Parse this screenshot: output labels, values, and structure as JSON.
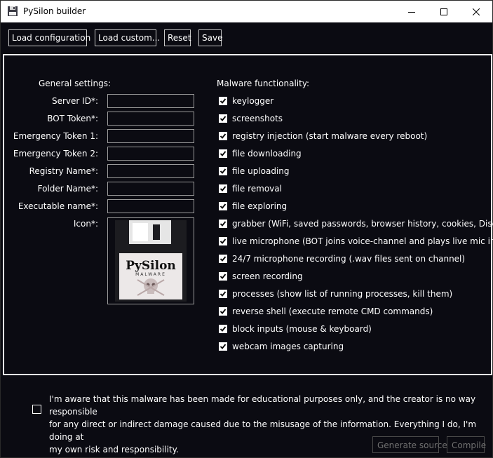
{
  "window": {
    "title": "PySilon builder",
    "app_icon": "floppy-disk-icon",
    "controls": [
      "minimize-icon",
      "maximize-icon",
      "close-icon"
    ]
  },
  "toolbar": {
    "load_configuration": "Load configuration",
    "load_custom": "Load custom...",
    "reset": "Reset",
    "save": "Save"
  },
  "general": {
    "heading": "General settings:",
    "fields": [
      {
        "label": "Server ID*:",
        "value": ""
      },
      {
        "label": "BOT Token*:",
        "value": ""
      },
      {
        "label": "Emergency Token 1:",
        "value": ""
      },
      {
        "label": "Emergency Token 2:",
        "value": ""
      },
      {
        "label": "Registry Name*:",
        "value": ""
      },
      {
        "label": "Folder Name*:",
        "value": ""
      },
      {
        "label": "Executable name*:",
        "value": ""
      }
    ],
    "icon_label": "Icon*:",
    "icon_image": {
      "brand_text": "PySilon",
      "sub_text": "MALWARE",
      "picture": "floppy-disk-skull-icon"
    }
  },
  "functionality": {
    "heading": "Malware functionality:",
    "items": [
      {
        "label": "keylogger",
        "checked": true
      },
      {
        "label": "screenshots",
        "checked": true
      },
      {
        "label": "registry injection (start malware every reboot)",
        "checked": true
      },
      {
        "label": "file downloading",
        "checked": true
      },
      {
        "label": "file uploading",
        "checked": true
      },
      {
        "label": "file removal",
        "checked": true
      },
      {
        "label": "file exploring",
        "checked": true
      },
      {
        "label": "grabber (WiFi, saved passwords, browser history, cookies, Discord)",
        "checked": true
      },
      {
        "label": "live microphone (BOT joins voice-channel and plays live mic input)",
        "checked": true
      },
      {
        "label": "24/7 microphone recording (.wav files sent on channel)",
        "checked": true
      },
      {
        "label": "screen recording",
        "checked": true
      },
      {
        "label": "processes (show list of running processes, kill them)",
        "checked": true
      },
      {
        "label": "reverse shell (execute remote CMD commands)",
        "checked": true
      },
      {
        "label": "block inputs (mouse & keyboard)",
        "checked": true
      },
      {
        "label": "webcam images capturing",
        "checked": true
      }
    ]
  },
  "agreement": {
    "checked": false,
    "line1": "I'm aware that this malware has been made for educational purposes only, and the creator is no way responsible",
    "line2": "for any direct or indirect damage caused due to the misusage of the information. Everything I do, I'm doing at",
    "line3": "my own risk and responsibility."
  },
  "actions": {
    "generate_source": "Generate source",
    "compile": "Compile"
  },
  "colors": {
    "background": "#0b0b12",
    "titlebar": "#ffffff",
    "text": "#ffffff",
    "disabled_text": "#707070"
  }
}
